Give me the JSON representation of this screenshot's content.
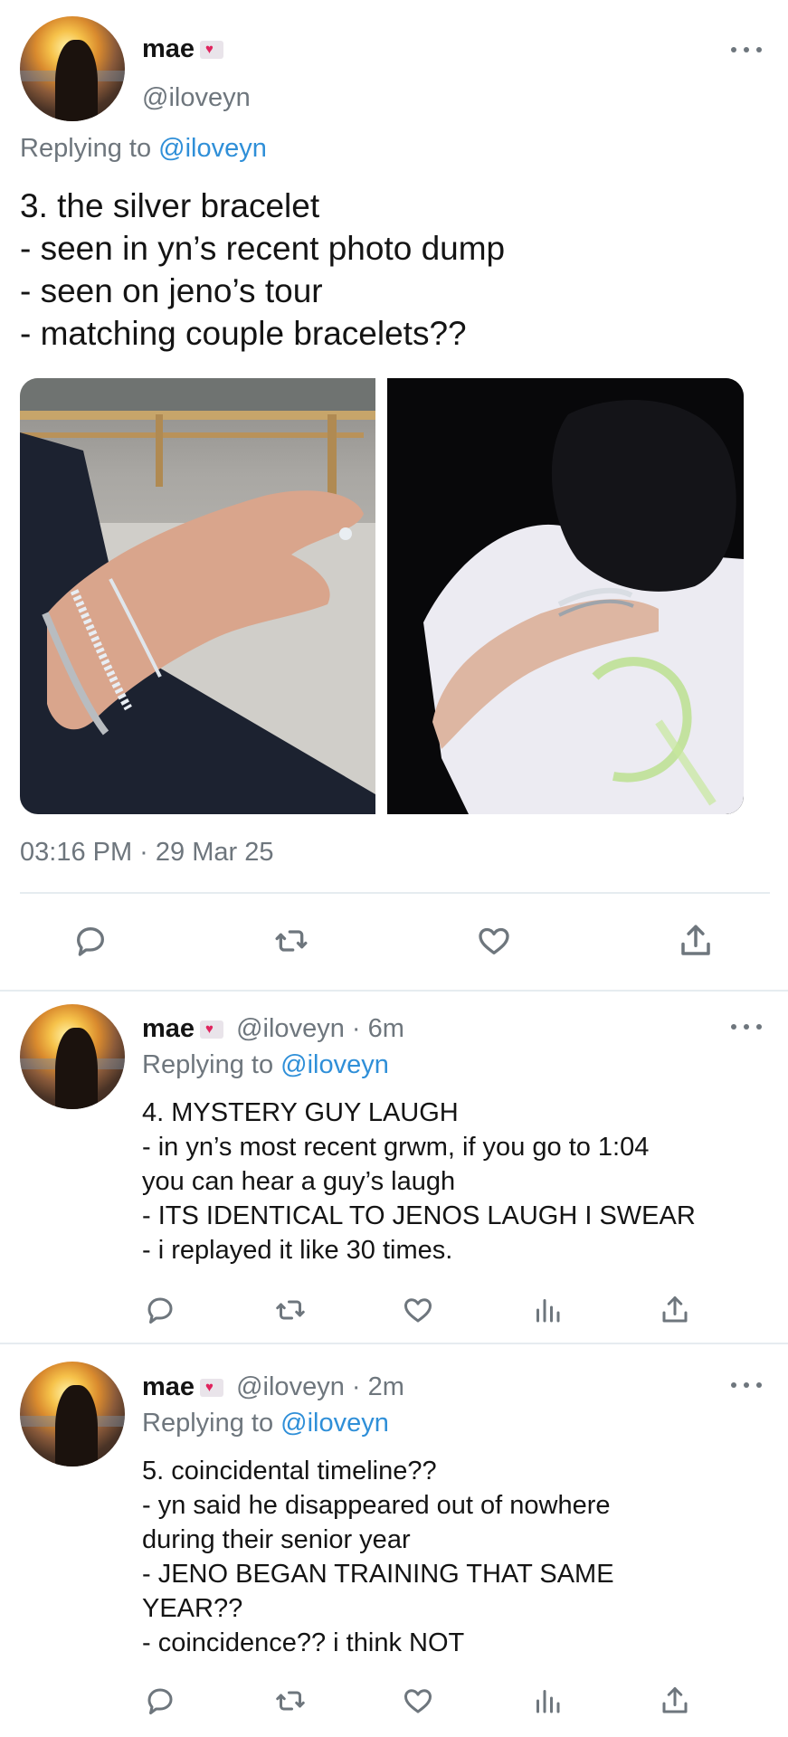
{
  "main_tweet": {
    "author_name": "mae",
    "handle": "@iloveyn",
    "replying_label": "Replying to",
    "replying_handle": "@iloveyn",
    "text": "3. the silver bracelet\n- seen in yn’s recent photo dump\n- seen on jeno’s tour\n- matching couple bracelets??",
    "timestamp": "03:16 PM · 29 Mar 25",
    "actions": [
      "reply-icon",
      "retweet-icon",
      "like-icon",
      "share-icon"
    ]
  },
  "replies": [
    {
      "author_name": "mae",
      "handle": "@iloveyn · 6m",
      "replying_label": "Replying to",
      "replying_handle": "@iloveyn",
      "text": "4. MYSTERY GUY LAUGH\n- in yn’s most recent grwm, if you go to 1:04\nyou can hear a guy’s laugh\n- ITS IDENTICAL TO JENOS LAUGH I SWEAR\n- i replayed it like 30 times.",
      "actions": [
        "reply-icon",
        "retweet-icon",
        "like-icon",
        "analytics-icon",
        "share-icon"
      ]
    },
    {
      "author_name": "mae",
      "handle": "@iloveyn · 2m",
      "replying_label": "Replying to",
      "replying_handle": "@iloveyn",
      "text": "5. coincidental timeline??\n- yn said he disappeared out of nowhere\nduring their senior year\n- JENO BEGAN TRAINING THAT SAME\nYEAR??\n- coincidence?? i think NOT",
      "actions": [
        "reply-icon",
        "retweet-icon",
        "like-icon",
        "analytics-icon",
        "share-icon"
      ]
    }
  ],
  "colors": {
    "link": "#2f8fd8",
    "muted": "#6e767d",
    "divider": "#e6ecf0"
  }
}
